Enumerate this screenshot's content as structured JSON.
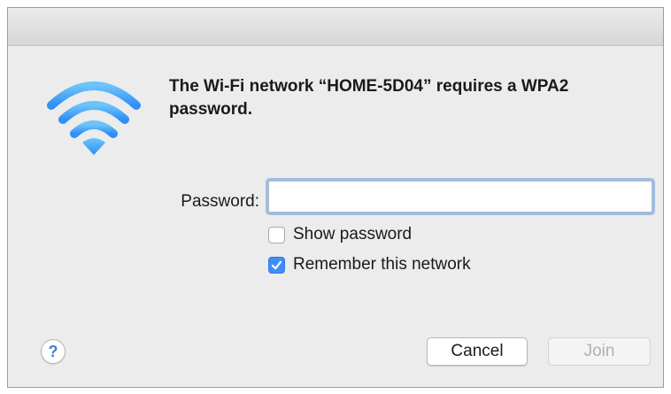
{
  "dialog": {
    "message": "The Wi-Fi network “HOME-5D04” requires a WPA2 password.",
    "icon": "wifi-icon",
    "accent_color": "#3f8ef7"
  },
  "password": {
    "label": "Password:",
    "value": "",
    "placeholder": ""
  },
  "options": {
    "show_password": {
      "label": "Show password",
      "checked": false
    },
    "remember_network": {
      "label": "Remember this network",
      "checked": true
    }
  },
  "buttons": {
    "help_label": "?",
    "cancel_label": "Cancel",
    "join_label": "Join",
    "join_enabled": false
  }
}
